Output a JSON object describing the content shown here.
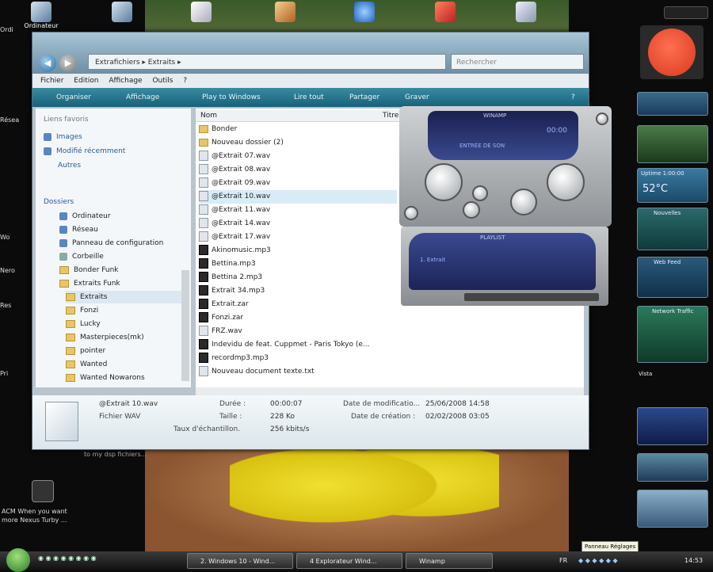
{
  "desktop": {
    "icons": [
      {
        "name": "computer-desktop-icon",
        "label": "Ordinateur"
      },
      {
        "name": "network-desktop-icon",
        "label": ""
      },
      {
        "name": "document-desktop-icon",
        "label": ""
      },
      {
        "name": "program-desktop-icon",
        "label": ""
      },
      {
        "name": "ie-desktop-icon",
        "label": ""
      },
      {
        "name": "app-desktop-icon",
        "label": ""
      },
      {
        "name": "recycle-bin-desktop-icon",
        "label": ""
      }
    ],
    "side_labels": [
      "Ordi",
      "Résea",
      "Wo",
      "Nero",
      "Res",
      "Pri"
    ],
    "acm_text": "ACM When you want more Nexus Turby ...",
    "hidden_text": "to my dsp fichiers..."
  },
  "explorer": {
    "breadcrumb": "Extrafichiers ▸ Extraits ▸",
    "search_placeholder": "Rechercher",
    "menu": [
      "Fichier",
      "Edition",
      "Affichage",
      "Outils",
      "?"
    ],
    "toolbar": [
      "Organiser",
      "Affichage",
      "Play to Windows",
      "Lire tout",
      "Partager",
      "Graver"
    ],
    "nav_header": "Liens favoris",
    "nav_favs": [
      "Images",
      "Modifié récemment",
      "Autres"
    ],
    "nav_folders_header": "Dossiers",
    "nav_tree": [
      "Ordinateur",
      "Réseau",
      "Panneau de configuration",
      "Corbeille",
      "Bonder Funk",
      "Extraits Funk",
      "Extraits",
      "Fonzi",
      "Lucky",
      "Masterpieces(mk)",
      "pointer",
      "Wanted",
      "Wanted Nowarons"
    ],
    "column_name": "Nom",
    "column_other": "Titre",
    "files": [
      "Bonder",
      "Nouveau dossier (2)",
      "@Extrait 07.wav",
      "@Extrait 08.wav",
      "@Extrait 09.wav",
      "@Extrait 10.wav",
      "@Extrait 11.wav",
      "@Extrait 14.wav",
      "@Extrait 17.wav",
      "Akinomusic.mp3",
      "Bettina.mp3",
      "Bettina 2.mp3",
      "Extrait 34.mp3",
      "Extrait.zar",
      "Fonzi.zar",
      "FRZ.wav",
      "Indevidu de feat. Cuppmet - Paris Tokyo (e...",
      "recordmp3.mp3",
      "Nouveau document texte.txt"
    ],
    "details": {
      "filename": "@Extrait 10.wav",
      "type": "Fichier WAV",
      "duree_label": "Durée :",
      "duree": "00:00:07",
      "taille_label": "Taille :",
      "taille": "228 Ko",
      "debit_label": "Taux d'échantillon.",
      "debit": "256 kbits/s",
      "modif_label": "Date de modificatio...",
      "modif": "25/06/2008 14:58",
      "creation_label": "Date de création :",
      "creation": "02/02/2008 03:05"
    }
  },
  "winamp": {
    "title": "WINAMP",
    "time": "00:00",
    "track": "ENTRÉE DE SON",
    "pl_title": "PLAYLIST",
    "playlist_item": "1. Extrait"
  },
  "gadgets": {
    "weather_temp": "52°C",
    "weather_text": "Uptime 1:00:00",
    "news_title": "Nouvelles",
    "network_title": "Network Traffic",
    "feed_title": "Web Feed",
    "stock_title": "Vista"
  },
  "taskbar": {
    "tasks": [
      "2. Windows 10 - Wind...",
      "4 Explorateur Wind...",
      "Winamp"
    ],
    "tray_lang": "FR",
    "tray_time": "14:53",
    "tooltip": "Panneau Réglages"
  }
}
